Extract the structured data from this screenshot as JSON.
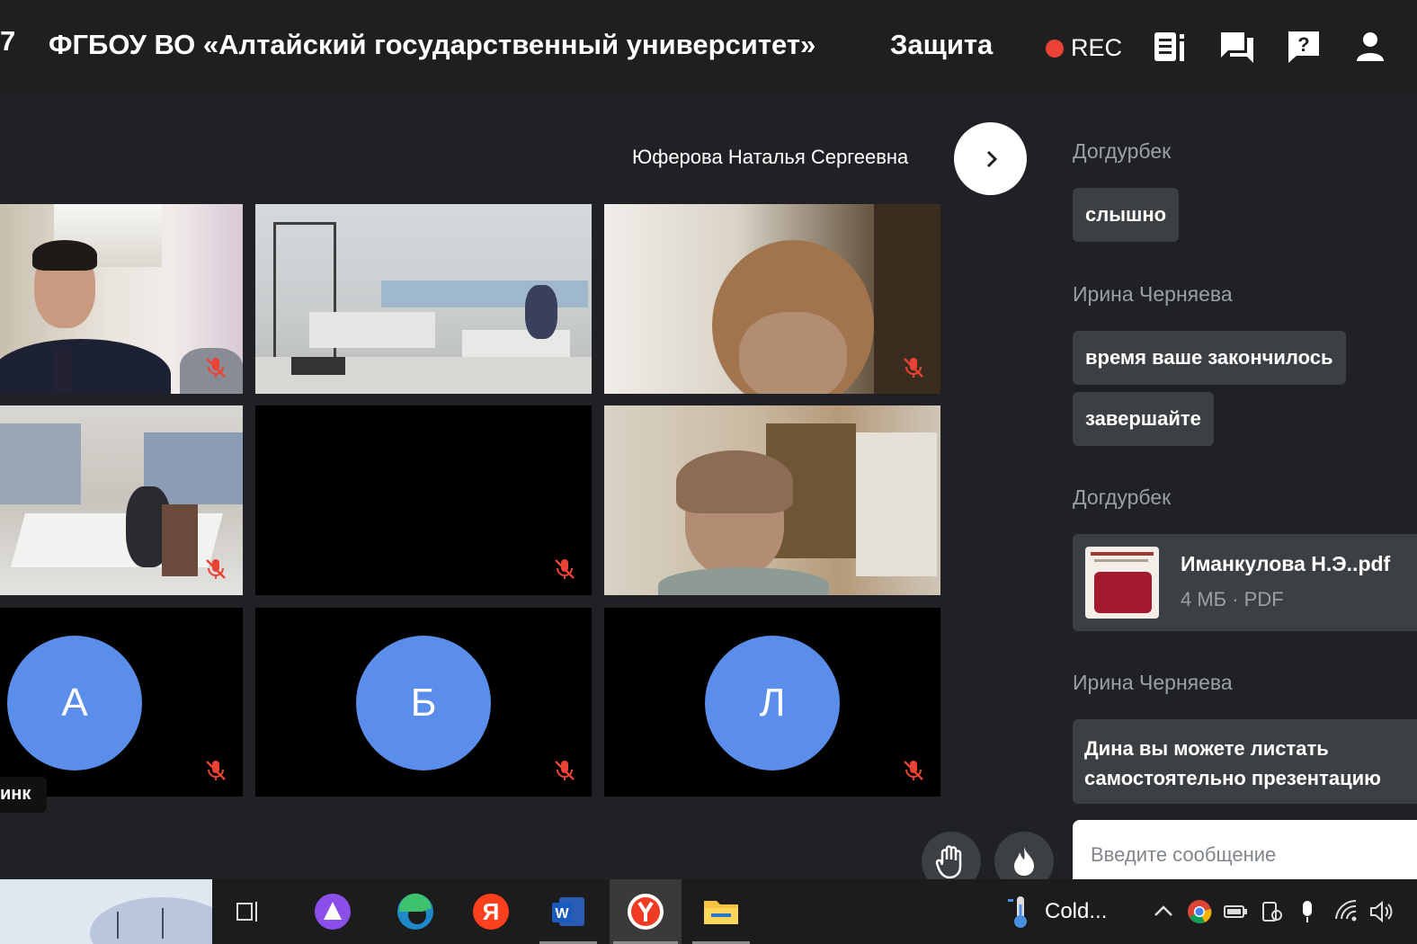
{
  "header": {
    "title_fragment": "7",
    "title": "ФГБОУ ВО «Алтайский государственный университет»",
    "section": "Защита",
    "rec_label": "REC"
  },
  "stage": {
    "speaker_name": "Юферова Наталья Сергеевна",
    "avatars": [
      {
        "letter": "А",
        "color": "#5b8dea"
      },
      {
        "letter": "Б",
        "color": "#5b8dea"
      },
      {
        "letter": "Л",
        "color": "#5b8dea"
      }
    ],
    "name_chip": "инк"
  },
  "chat": {
    "messages": [
      {
        "sender": "Догдурбек",
        "texts": [
          "слышно"
        ]
      },
      {
        "sender": "Ирина Черняева",
        "texts": [
          "время ваше закончилось",
          "завершайте"
        ]
      },
      {
        "sender": "Догдурбек",
        "file": {
          "name": "Иманкулова Н.Э..pdf",
          "meta": "4 МБ · PDF"
        }
      },
      {
        "sender": "Ирина Черняева",
        "lines": [
          "Дина вы можете листать",
          "самостоятельно презентацию"
        ]
      }
    ],
    "input_placeholder": "Введите сообщение"
  },
  "taskbar": {
    "weather_text": "Cold..."
  },
  "colors": {
    "avatar": "#5b8dea",
    "rec": "#ea4335",
    "mic_off": "#ea4335",
    "bubble": "#3c4043"
  }
}
